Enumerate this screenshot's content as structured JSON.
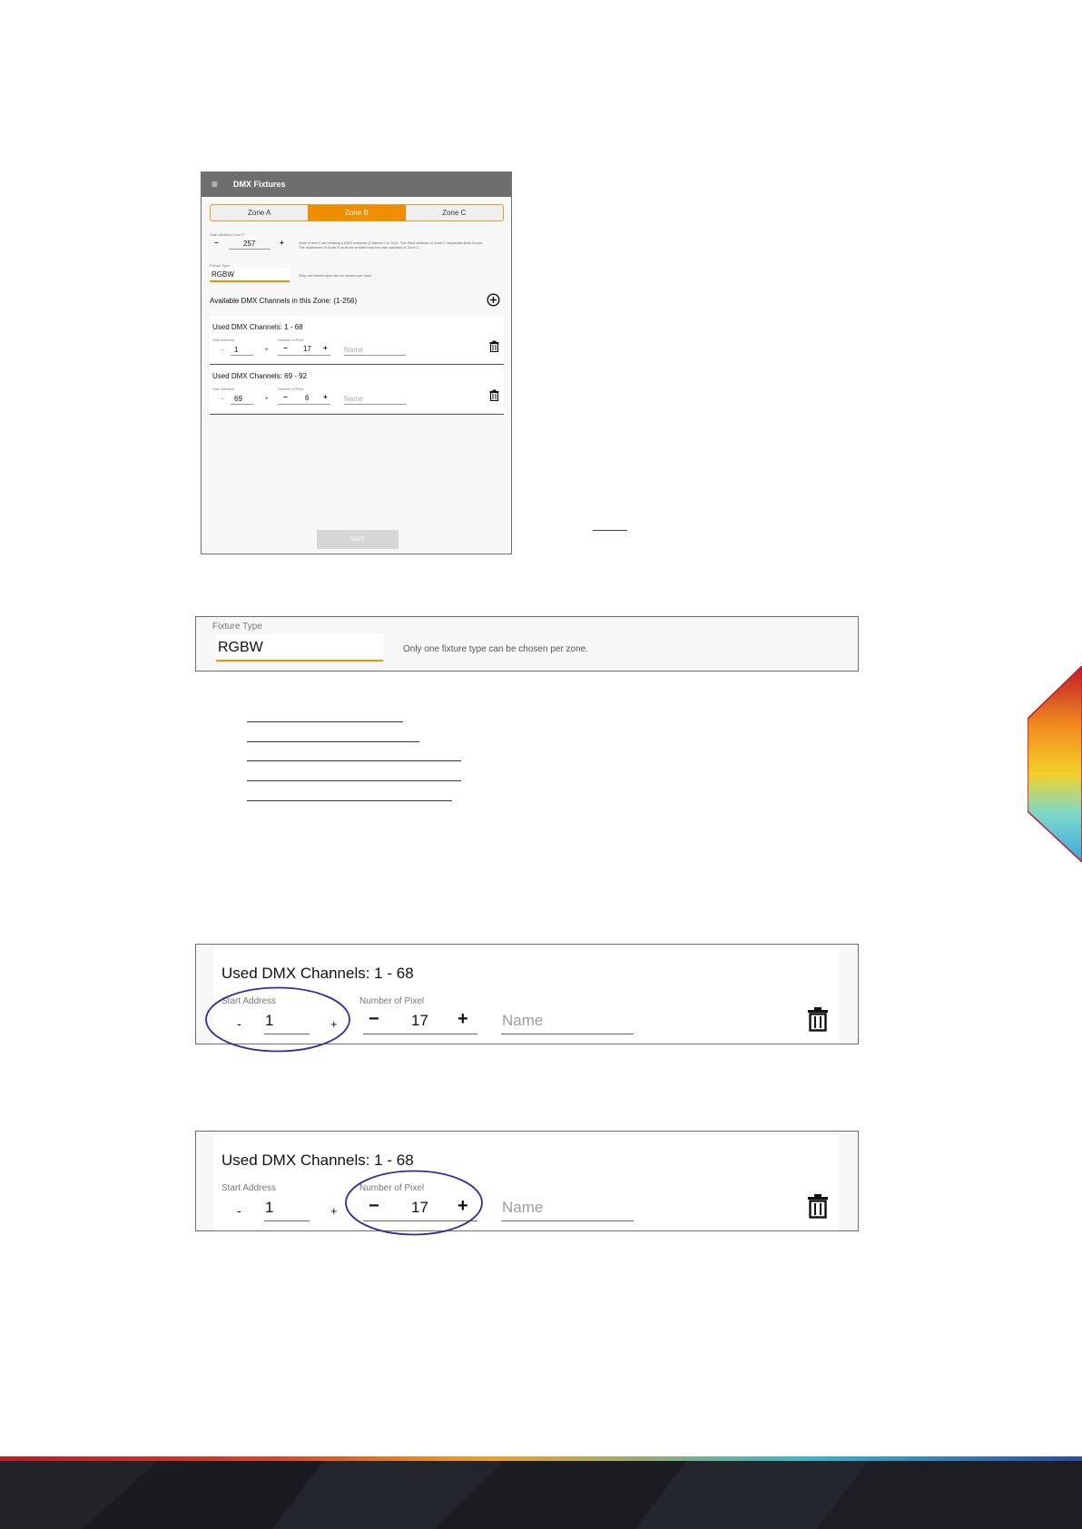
{
  "app": {
    "menu_glyph": "≡",
    "title": "DMX Fixtures",
    "tabs": [
      "Zone A",
      "Zone B",
      "Zone C"
    ],
    "active_tab": "Zone B",
    "start_address_label": "Start Address Zone C",
    "start_address_minus": "−",
    "start_address_value": "257",
    "start_address_plus": "+",
    "zone_info_line1": "Zone B and C are sharing a DMX universe (Channel 1 to 512). The Start address of Zone C separates both Zones.",
    "zone_info_line2": "The addresses of Zone B must be smaller than the start address of Zone C.",
    "fixture_type_label": "Fixture Type",
    "fixture_type_value": "RGBW",
    "fixture_type_hint": "Only one fixture type can be chosen per zone.",
    "available_channels": "Available DMX Channels in this Zone: (1-256)",
    "entries": [
      {
        "title": "Used DMX Channels: 1 - 68",
        "start_label": "Start Address",
        "start_minus": "-",
        "start_value": "1",
        "start_plus": "+",
        "pixel_label": "Number of Pixel",
        "pixel_minus": "−",
        "pixel_value": "17",
        "pixel_plus": "+",
        "name_placeholder": "Name"
      },
      {
        "title": "Used DMX Channels: 69 - 92",
        "start_label": "Start Address",
        "start_minus": "-",
        "start_value": "69",
        "start_plus": "+",
        "pixel_label": "Number of Pixel",
        "pixel_minus": "−",
        "pixel_value": "6",
        "pixel_plus": "+",
        "name_placeholder": "Name"
      }
    ],
    "save_label": "SAVE"
  },
  "fixture_panel": {
    "label": "Fixture Type",
    "value": "RGBW",
    "hint": "Only one fixture type can be chosen per zone."
  },
  "detail_panels": [
    {
      "title": "Used DMX Channels: 1 - 68",
      "start_label": "Start Address",
      "start_minus": "-",
      "start_value": "1",
      "start_plus": "+",
      "pixel_label": "Number of Pixel",
      "pixel_minus": "−",
      "pixel_value": "17",
      "pixel_plus": "+",
      "name_placeholder": "Name",
      "highlight": "start-address"
    },
    {
      "title": "Used DMX Channels: 1 - 68",
      "start_label": "Start Address",
      "start_minus": "-",
      "start_value": "1",
      "start_plus": "+",
      "pixel_label": "Number of Pixel",
      "pixel_minus": "−",
      "pixel_value": "17",
      "pixel_plus": "+",
      "name_placeholder": "Name",
      "highlight": "number-of-pixel"
    }
  ],
  "colors": {
    "accent": "#ef8e00",
    "highlight_ellipse": "#3a2a9a",
    "app_bar": "#6e6e6e",
    "footer": "#1c1d22"
  },
  "icons": [
    "menu-icon",
    "add-circle-icon",
    "trash-icon"
  ]
}
